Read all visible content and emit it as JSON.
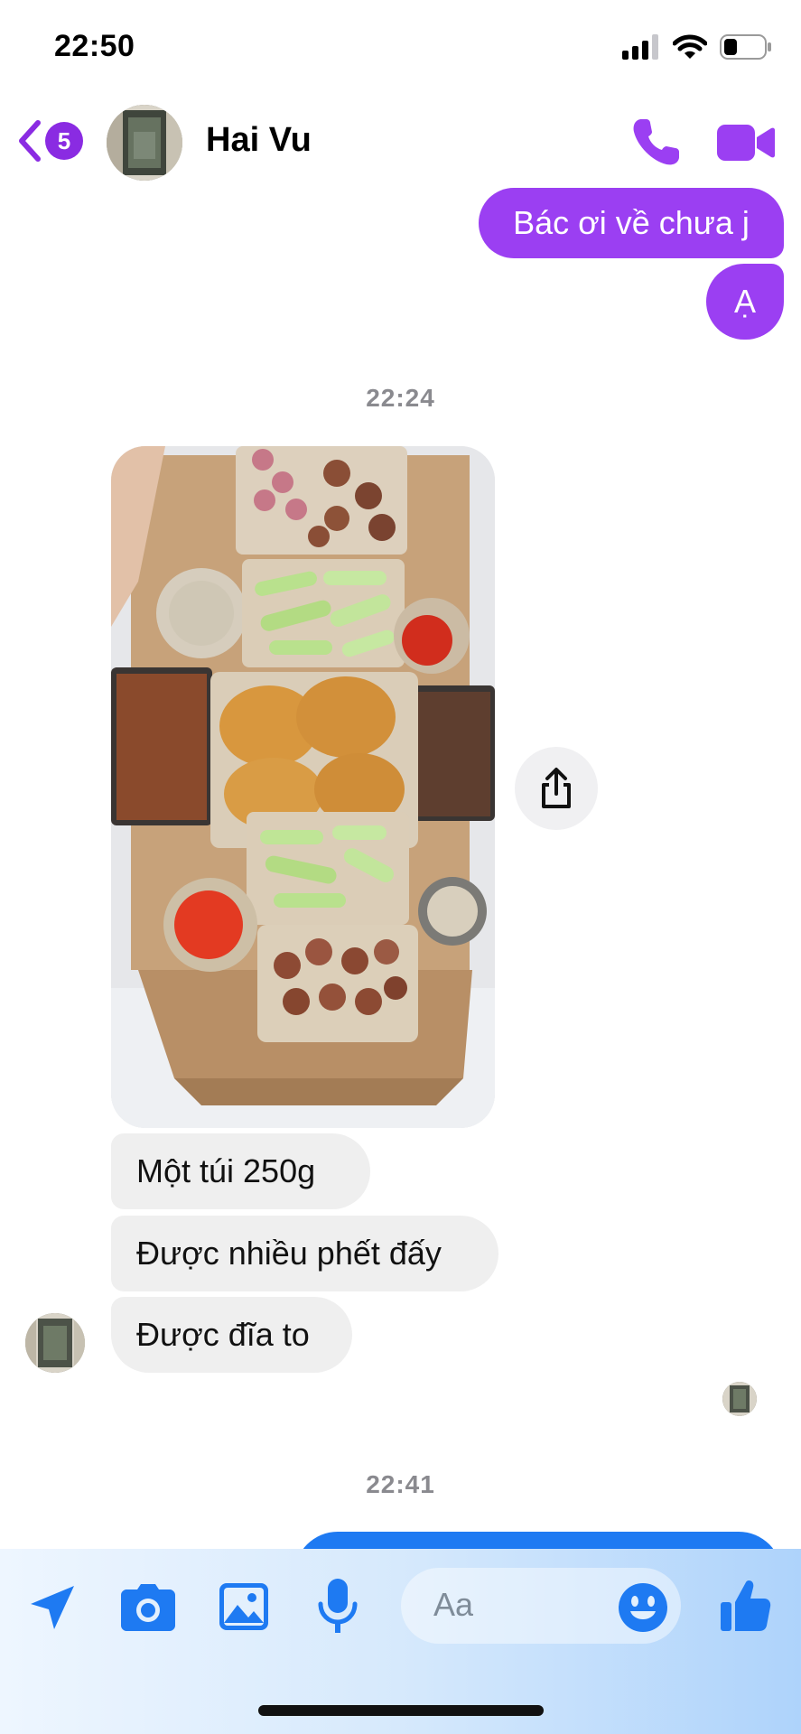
{
  "status_bar": {
    "time": "22:50",
    "icons": [
      "signal-icon",
      "wifi-icon",
      "battery-icon"
    ]
  },
  "header": {
    "back_count": "5",
    "contact_name": "Hai Vu",
    "icons": [
      "back-chevron-icon",
      "phone-icon",
      "video-camera-icon"
    ]
  },
  "messages": {
    "out_1": "Bác ơi về chưa j",
    "out_2": "Ạ",
    "timestamp_1": "22:24",
    "in_1": "Một túi 250g",
    "in_2": "Được nhiều phết đấy",
    "in_3": "Được đĩa to",
    "timestamp_2": "22:41"
  },
  "composer": {
    "placeholder": "Aa",
    "icons": [
      "send-location-icon",
      "camera-icon",
      "image-icon",
      "microphone-icon",
      "emoji-icon",
      "thumbs-up-icon"
    ]
  },
  "colors": {
    "accent_purple": "#9b3ff2",
    "accent_blue": "#1e7af2",
    "incoming_bubble": "#efefef"
  }
}
